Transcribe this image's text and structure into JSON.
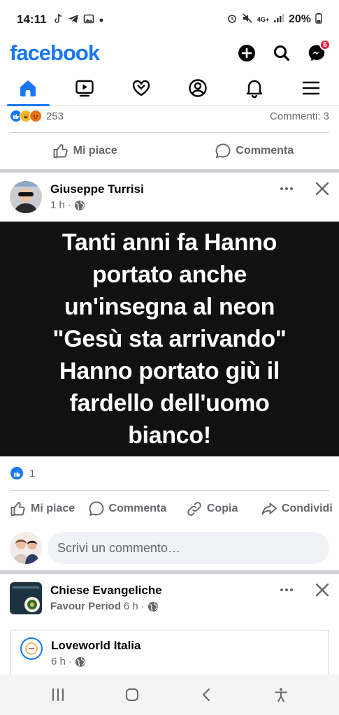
{
  "status_bar": {
    "time": "14:11",
    "network": "4G+",
    "battery": "20%"
  },
  "header": {
    "logo": "facebook",
    "messenger_badge": "6"
  },
  "nav_tabs": [
    {
      "icon": "home-icon"
    },
    {
      "icon": "video-icon"
    },
    {
      "icon": "dating-heart-icon"
    },
    {
      "icon": "profile-icon"
    },
    {
      "icon": "bell-icon"
    },
    {
      "icon": "menu-icon"
    }
  ],
  "prev_post": {
    "reaction_count": "253",
    "comments": "Commenti: 3",
    "like_label": "Mi piace",
    "comment_label": "Commenta"
  },
  "post": {
    "author": "Giuseppe Turrisi",
    "time": "1 h ·",
    "quote": "Tanti anni fa Hanno portato anche un'insegna al neon \"Gesù sta arrivando\" Hanno portato giù il fardello dell'uomo bianco!",
    "reaction_count": "1",
    "actions": {
      "like": "Mi piace",
      "comment": "Commenta",
      "copy": "Copia",
      "share": "Condividi"
    },
    "comment_placeholder": "Scrivi un commento…"
  },
  "next_post": {
    "author": "Chiese Evangeliche",
    "sub_author": "Favour Period",
    "time": "6 h ·",
    "shared": {
      "author": "Loveworld Italia",
      "time": "6 h ·"
    }
  },
  "colors": {
    "brand": "#1877f2",
    "secondary_text": "#65676b",
    "quote_bg": "#111111"
  }
}
